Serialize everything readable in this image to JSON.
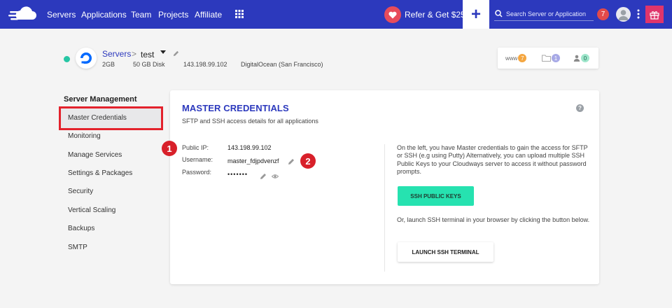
{
  "nav": {
    "links": [
      "Servers",
      "Applications",
      "Team",
      "Projects",
      "Affiliate"
    ],
    "refer_label": "Refer & Get $25",
    "search_placeholder": "Search Server or Application",
    "notification_count": "7"
  },
  "server": {
    "breadcrumb_root": "Servers",
    "breadcrumb_sep": ">",
    "name": "test",
    "ram": "2GB",
    "disk": "50 GB Disk",
    "ip": "143.198.99.102",
    "provider": "DigitalOcean (San Francisco)",
    "stats": [
      {
        "label": "www",
        "count": "7",
        "color": "#f4a640"
      },
      {
        "label": "",
        "count": "1",
        "color": "#a7a9e6"
      },
      {
        "label": "",
        "count": "0",
        "color": "#9ee6cb"
      }
    ]
  },
  "sidebar": {
    "title": "Server Management",
    "items": [
      "Master Credentials",
      "Monitoring",
      "Manage Services",
      "Settings & Packages",
      "Security",
      "Vertical Scaling",
      "Backups",
      "SMTP"
    ]
  },
  "card": {
    "title": "MASTER CREDENTIALS",
    "subtitle": "SFTP and SSH access details for all applications",
    "public_ip_label": "Public IP:",
    "public_ip": "143.198.99.102",
    "username_label": "Username:",
    "username": "master_fdjpdvenzf",
    "password_label": "Password:",
    "password_mask": "•••••••",
    "marker_1": "1",
    "marker_2": "2",
    "info_text": "On the left, you have Master credentials to gain the access for SFTP or SSH (e.g using Putty) Alternatively, you can upload multiple SSH Public Keys to your Cloudways server to access it without password prompts.",
    "ssh_keys_button": "SSH PUBLIC KEYS",
    "terminal_text": "Or, launch SSH terminal in your browser by clicking the button below.",
    "terminal_button": "LAUNCH SSH TERMINAL",
    "help": "?"
  },
  "colors": {
    "nav_bg": "#2c39bd",
    "accent_green": "#26e2b0",
    "highlight_red": "#e3222c"
  }
}
